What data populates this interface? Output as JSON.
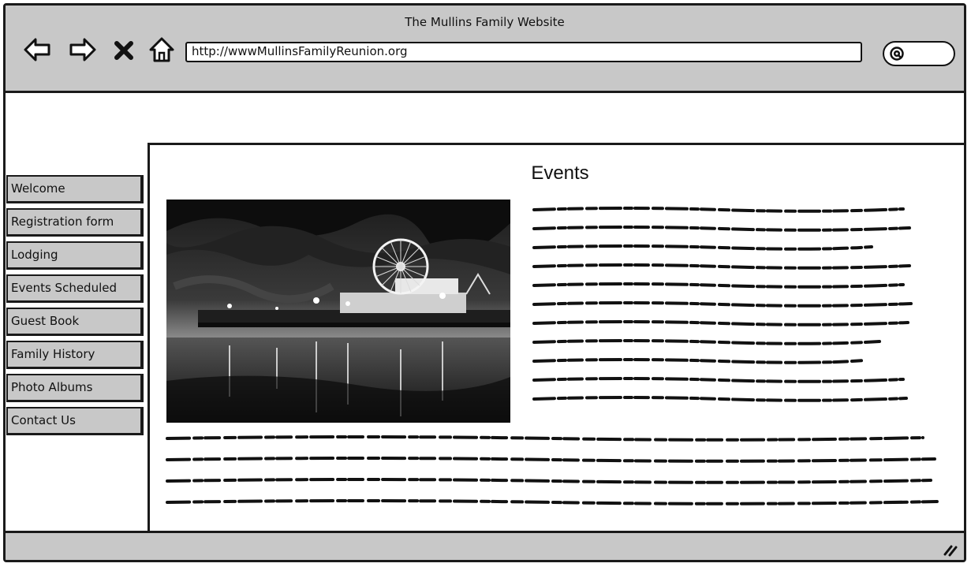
{
  "window": {
    "title": "The Mullins Family Website"
  },
  "toolbar": {
    "icons": [
      "back-icon",
      "forward-icon",
      "stop-icon",
      "home-icon"
    ],
    "address": "http://wwwMullinsFamilyReunion.org",
    "search_icon": "search-icon"
  },
  "sidebar": {
    "items": [
      {
        "label": "Welcome"
      },
      {
        "label": "Registration form"
      },
      {
        "label": "Lodging"
      },
      {
        "label": "Events Scheduled"
      },
      {
        "label": "Guest Book"
      },
      {
        "label": "Family History"
      },
      {
        "label": "Photo Albums"
      },
      {
        "label": "Contact Us"
      }
    ]
  },
  "main": {
    "title": "Events",
    "image": "pier-ferris-wheel-night-photo"
  },
  "colors": {
    "chrome": "#c8c8c8",
    "border": "#1a1a1a",
    "background": "#ffffff"
  }
}
